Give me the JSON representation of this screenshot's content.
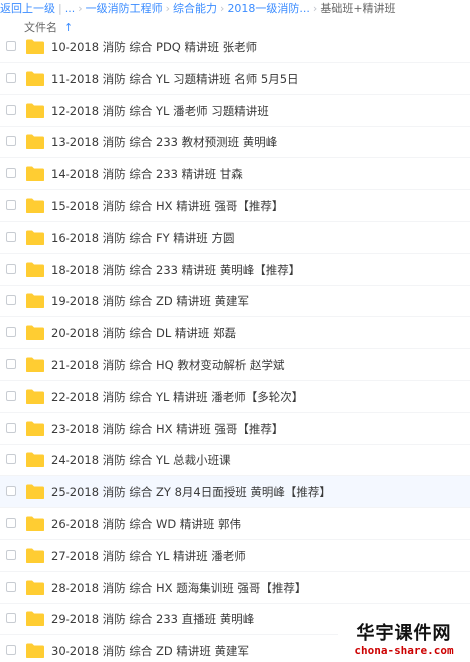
{
  "breadcrumb": {
    "back": "返回上一级",
    "ellipsis": "...",
    "items": [
      "一级消防工程师",
      "综合能力",
      "2018一级消防..."
    ],
    "current": "基础班+精讲班"
  },
  "column_header": {
    "file_name": "文件名",
    "sort_icon": "arrow-up-icon",
    "sort_glyph": "↑"
  },
  "folder_color": "#ffcc33",
  "files": [
    {
      "name": "10-2018 消防 综合 PDQ 精讲班 张老师"
    },
    {
      "name": "11-2018 消防 综合 YL 习题精讲班 名师 5月5日"
    },
    {
      "name": "12-2018 消防 综合 YL 潘老师 习题精讲班"
    },
    {
      "name": "13-2018 消防 综合 233 教材预测班 黄明峰"
    },
    {
      "name": "14-2018 消防 综合 233 精讲班 甘森"
    },
    {
      "name": "15-2018 消防 综合 HX 精讲班 强哥【推荐】"
    },
    {
      "name": "16-2018 消防 综合 FY 精讲班 方圆"
    },
    {
      "name": "18-2018 消防 综合 233 精讲班 黄明峰【推荐】"
    },
    {
      "name": "19-2018 消防 综合 ZD 精讲班 黄建军"
    },
    {
      "name": "20-2018 消防 综合 DL 精讲班 郑磊"
    },
    {
      "name": "21-2018 消防 综合 HQ 教材变动解析 赵学斌"
    },
    {
      "name": "22-2018 消防 综合 YL 精讲班 潘老师【多轮次】"
    },
    {
      "name": "23-2018 消防 综合 HX 精讲班 强哥【推荐】"
    },
    {
      "name": "24-2018 消防 综合 YL 总裁小班课"
    },
    {
      "name": "25-2018 消防 综合 ZY 8月4日面授班 黄明峰【推荐】",
      "highlighted": true
    },
    {
      "name": "26-2018 消防 综合 WD 精讲班 郭伟"
    },
    {
      "name": "27-2018 消防 综合 YL 精讲班 潘老师"
    },
    {
      "name": "28-2018 消防 综合 HX 题海集训班 强哥【推荐】"
    },
    {
      "name": "29-2018 消防 综合 233 直播班 黄明峰"
    },
    {
      "name": "30-2018 消防 综合 ZD 精讲班 黄建军"
    }
  ],
  "watermark": {
    "title": "华宇课件网",
    "url": "chona-share.com"
  }
}
